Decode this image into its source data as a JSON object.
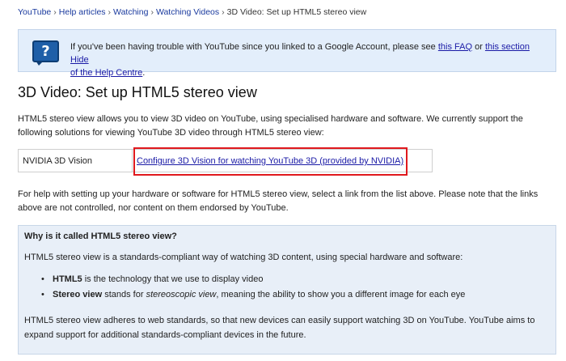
{
  "breadcrumb": {
    "items": [
      "YouTube",
      "Help articles",
      "Watching",
      "Watching Videos"
    ],
    "separator": "›",
    "current": "3D Video: Set up HTML5 stereo view"
  },
  "notice": {
    "icon": "help-question-icon",
    "text_before": "If you've been having trouble with YouTube since you linked to a Google Account, please see ",
    "faq_link": "this FAQ",
    "text_or": " or ",
    "section_link": "this section",
    "hide_link": "Hide",
    "help_centre_link": "of the Help Centre",
    "text_end": "."
  },
  "page": {
    "title": "3D Video: Set up HTML5 stereo view",
    "intro": "HTML5 stereo view allows you to view 3D video on YouTube, using specialised hardware and software. We currently support the following solutions for viewing YouTube 3D video through HTML5 stereo view:",
    "table": {
      "rows": [
        {
          "name": "NVIDIA 3D Vision",
          "link": "Configure 3D Vision for watching YouTube 3D (provided by NVIDIA)"
        }
      ]
    },
    "help_text": "For help with setting up your hardware or software for HTML5 stereo view, select a link from the list above. Please note that the links above are not controlled, nor content on them endorsed by YouTube."
  },
  "faq": {
    "title": "Why is it called HTML5 stereo view?",
    "para1": "HTML5 stereo view is a standards-compliant way of watching 3D content, using special hardware and software:",
    "bullets": [
      {
        "term": "HTML5",
        "text": " is the technology that we use to display video"
      },
      {
        "term": "Stereo view",
        "text_before": " stands for ",
        "em": "stereoscopic view",
        "text_after": ", meaning the ability to show you a different image for each eye"
      }
    ],
    "bullet_glyph": "•",
    "para2": "HTML5 stereo view adheres to web standards, so that new devices can easily support watching 3D on YouTube. YouTube aims to expand support for additional standards-compliant devices in the future."
  },
  "colors": {
    "notice_bg": "#e3eefb",
    "faq_bg": "#e8eff8",
    "link": "#1a1aa6",
    "highlight": "#e0191e"
  }
}
